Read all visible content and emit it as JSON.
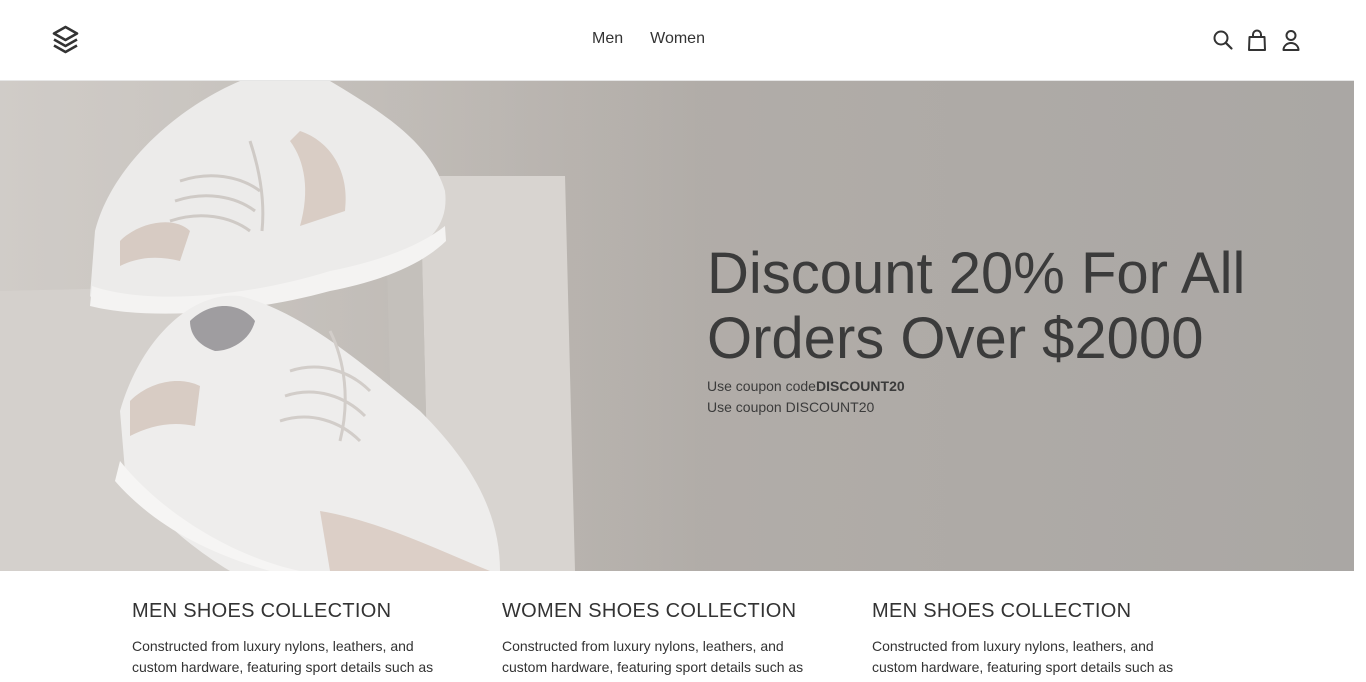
{
  "header": {
    "logo_icon": "layered-stack-logo",
    "nav": [
      "Men",
      "Women"
    ],
    "icons": [
      "search-icon",
      "bag-icon",
      "user-icon"
    ]
  },
  "hero": {
    "title_line1": "Discount 20% For All",
    "title_line2": "Orders Over $2000",
    "coupon_prefix": "Use coupon code",
    "coupon_code": "DISCOUNT20",
    "coupon_line2": "Use coupon DISCOUNT20"
  },
  "collections": [
    {
      "title": "MEN SHOES COLLECTION",
      "text": "Constructed from luxury nylons, leathers, and custom hardware, featuring sport details such as hidden"
    },
    {
      "title": "WOMEN SHOES COLLECTION",
      "text": "Constructed from luxury nylons, leathers, and custom hardware, featuring sport details such as hidden"
    },
    {
      "title": "MEN SHOES COLLECTION",
      "text": "Constructed from luxury nylons, leathers, and custom hardware, featuring sport details such as hidden"
    }
  ],
  "colors": {
    "text": "#333333",
    "hero_bg": "#b3aea9",
    "border": "#e6e6e6"
  }
}
